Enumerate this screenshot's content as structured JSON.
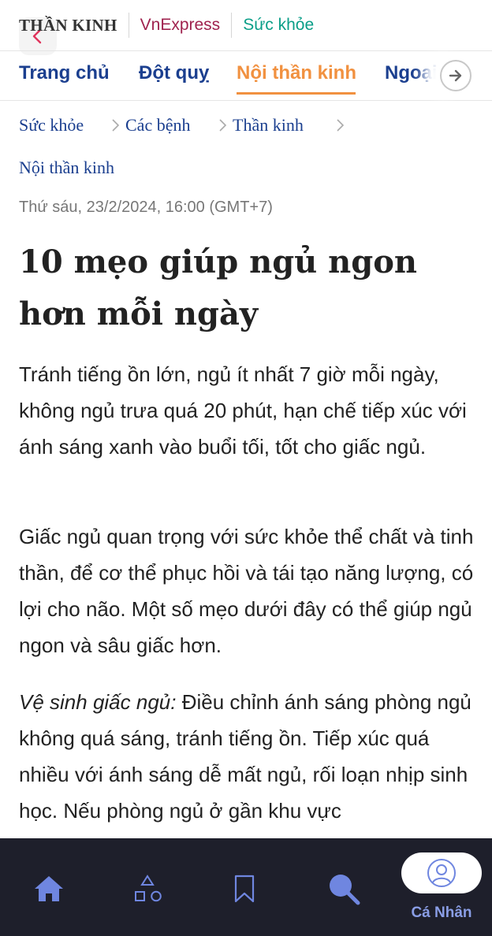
{
  "header": {
    "section": "THẦN KINH",
    "publisher": "VnExpress",
    "subsite": "Sức khỏe"
  },
  "nav": {
    "categories": [
      {
        "label": "Trang chủ",
        "active": false
      },
      {
        "label": "Đột quỵ",
        "active": false
      },
      {
        "label": "Nội thần kinh",
        "active": true
      },
      {
        "label": "Ngoại",
        "active": false
      }
    ]
  },
  "breadcrumb": [
    "Sức khỏe",
    "Các bệnh",
    "Thần kinh",
    "Nội thần kinh"
  ],
  "article": {
    "date": "Thứ sáu, 23/2/2024, 16:00 (GMT+7)",
    "title": "10 mẹo giúp ngủ ngon hơn mỗi ngày",
    "lead": "Tránh tiếng ồn lớn, ngủ ít nhất 7 giờ mỗi ngày, không ngủ trưa quá 20 phút, hạn chế tiếp xúc với ánh sáng xanh vào buổi tối, tốt cho giấc ngủ.",
    "paragraph1": "Giấc ngủ quan trọng với sức khỏe thể chất và tinh thần, để cơ thể phục hồi và tái tạo năng lượng, có lợi cho não. Một số mẹo dưới đây có thể giúp ngủ ngon và sâu giấc hơn.",
    "paragraph2_label": "Vệ sinh giấc ngủ:",
    "paragraph2_text": " Điều chỉnh ánh sáng phòng ngủ không quá sáng, tránh tiếng ồn. Tiếp xúc quá nhiều với ánh sáng dễ mất ngủ, rối loạn nhịp sinh học. Nếu phòng ngủ ở gần khu vực"
  },
  "bottom_nav": {
    "items": [
      "home-icon",
      "categories-icon",
      "bookmark-icon",
      "search-icon",
      "user-icon"
    ],
    "profile_label": "Cá Nhân"
  },
  "colors": {
    "nav_blue": "#1b3f8f",
    "active_orange": "#f19140",
    "vnexpress": "#9f224e",
    "suc_khoe": "#0a9e88",
    "bottom_bg": "#1e1f2b",
    "bottom_icon": "#6f86e0"
  }
}
